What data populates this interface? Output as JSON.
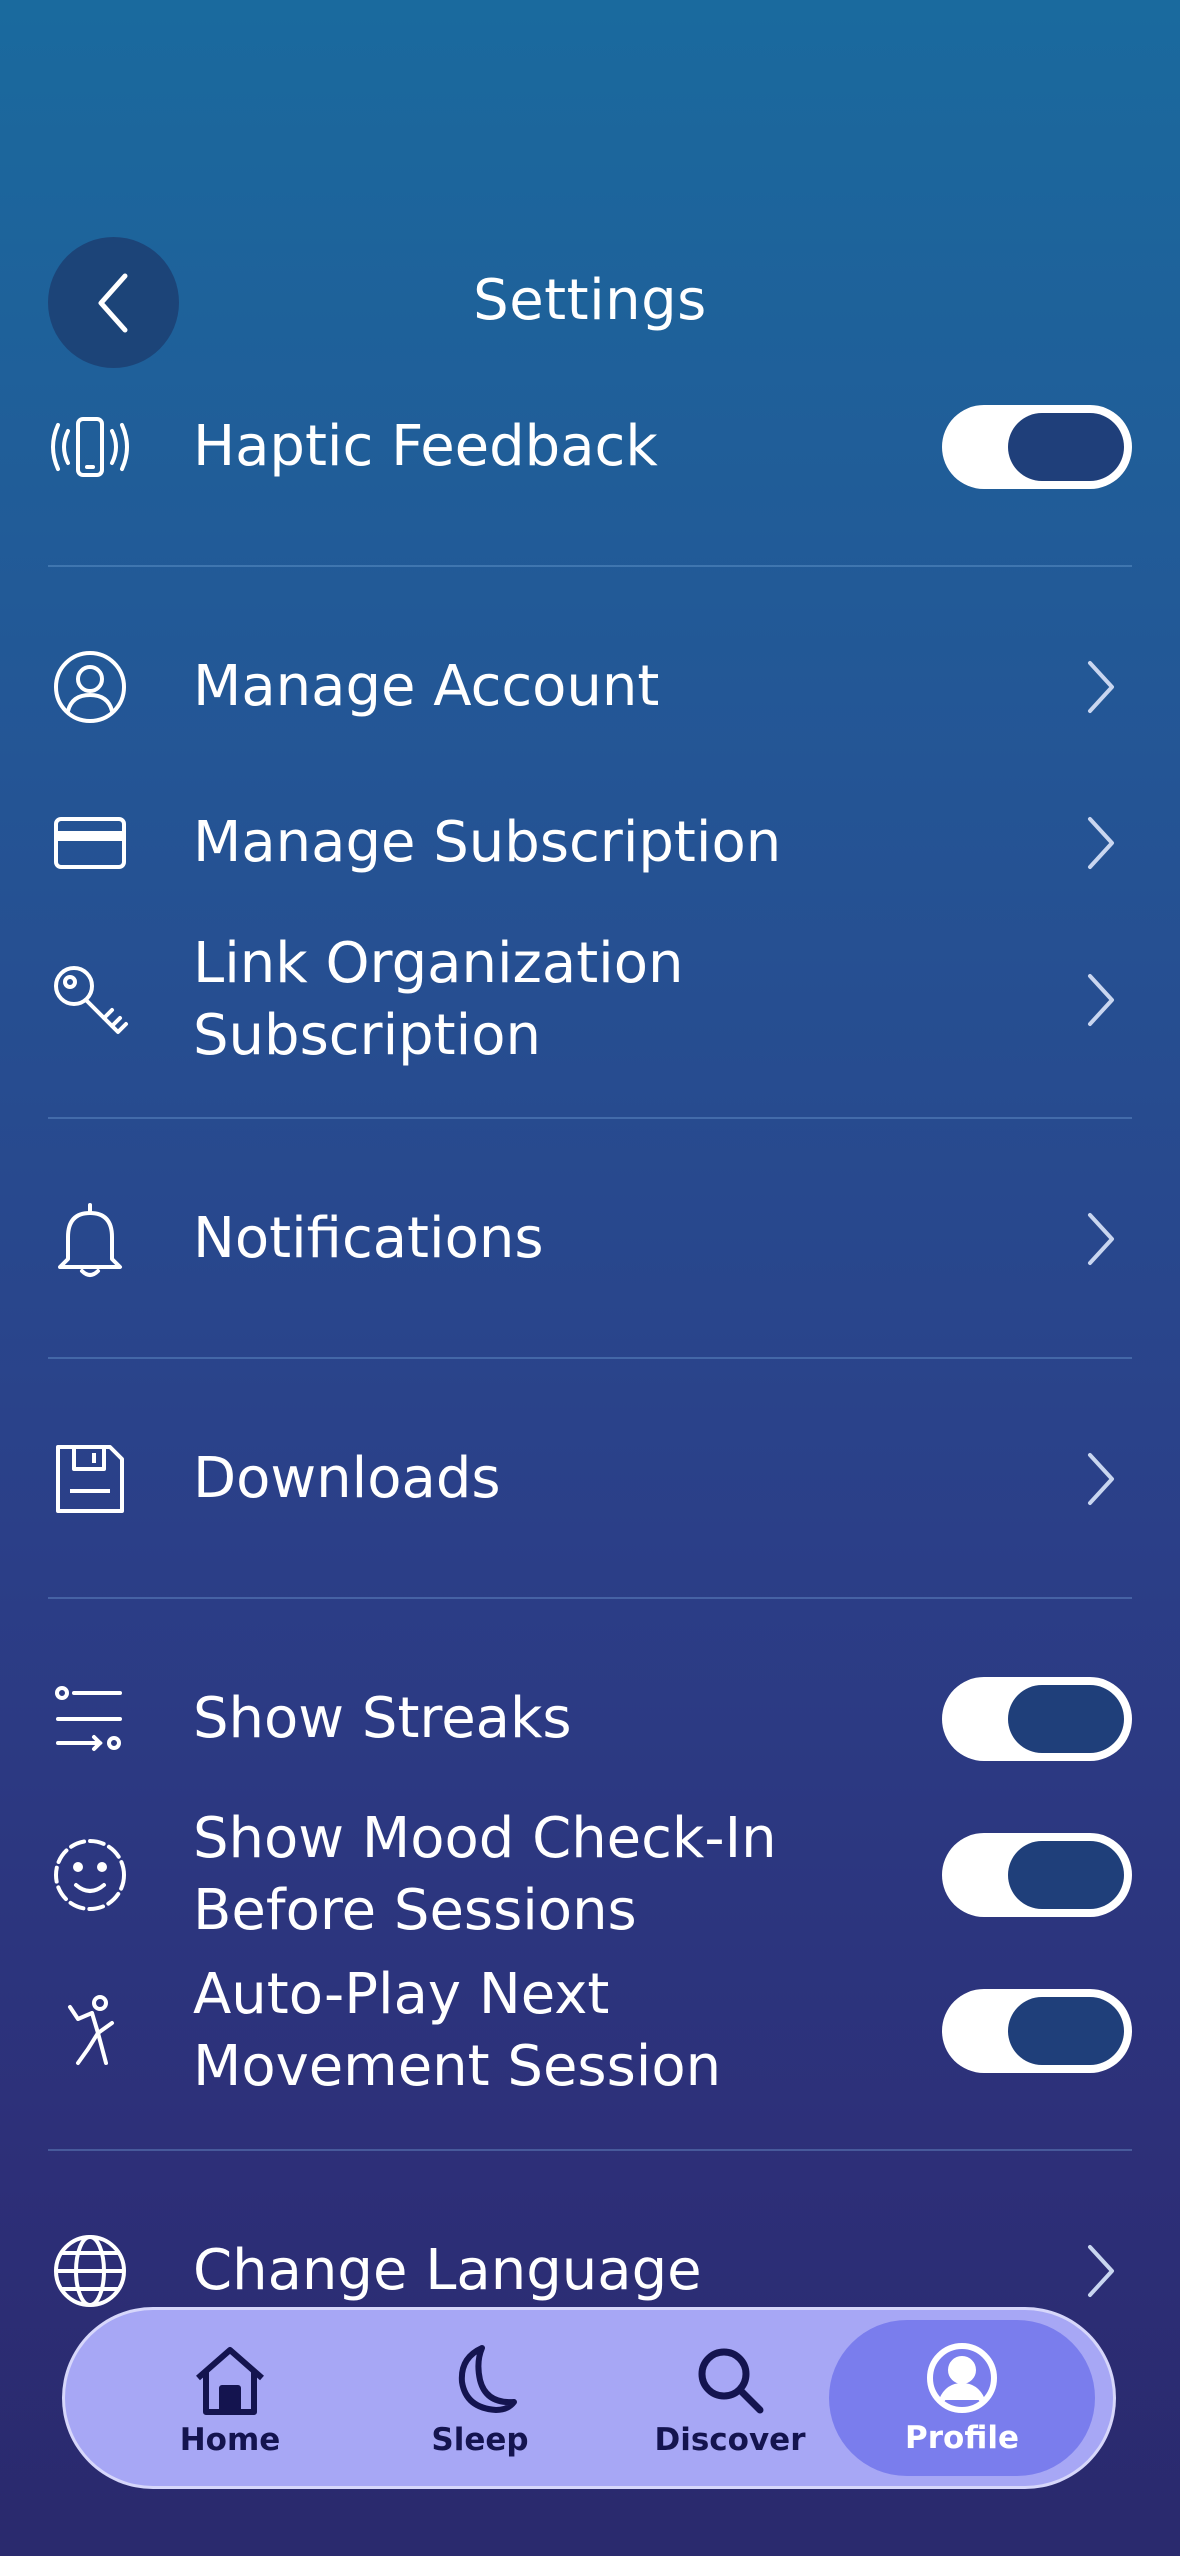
{
  "header": {
    "title": "Settings",
    "back_icon": "chevron-left-icon"
  },
  "colors": {
    "toggle_knob": "#1f3f7a",
    "tabbar": "#a7a7f5",
    "tab_active": "#7a7ded"
  },
  "settings": {
    "haptic": {
      "label": "Haptic Feedback",
      "icon": "vibrate-icon",
      "on": true
    },
    "manage_account": {
      "label": "Manage Account",
      "icon": "user-circle-icon"
    },
    "manage_subscription": {
      "label": "Manage Subscription",
      "icon": "credit-card-icon"
    },
    "link_org": {
      "line1": "Link Organization",
      "line2": "Subscription",
      "icon": "key-icon"
    },
    "notifications": {
      "label": "Notifications",
      "icon": "bell-icon"
    },
    "downloads": {
      "label": "Downloads",
      "icon": "floppy-icon"
    },
    "show_streaks": {
      "label": "Show Streaks",
      "icon": "sliders-icon",
      "on": true
    },
    "mood_checkin": {
      "line1": "Show Mood Check-In",
      "line2": "Before Sessions",
      "icon": "smiley-icon",
      "on": true
    },
    "autoplay": {
      "line1": "Auto-Play Next",
      "line2": "Movement Session",
      "icon": "movement-icon",
      "on": true
    },
    "change_language": {
      "label": "Change Language",
      "icon": "globe-icon"
    }
  },
  "tabbar": {
    "tabs": [
      {
        "label": "Home",
        "icon": "home-icon"
      },
      {
        "label": "Sleep",
        "icon": "moon-icon"
      },
      {
        "label": "Discover",
        "icon": "search-icon"
      },
      {
        "label": "Profile",
        "icon": "profile-icon",
        "active": true
      }
    ]
  }
}
